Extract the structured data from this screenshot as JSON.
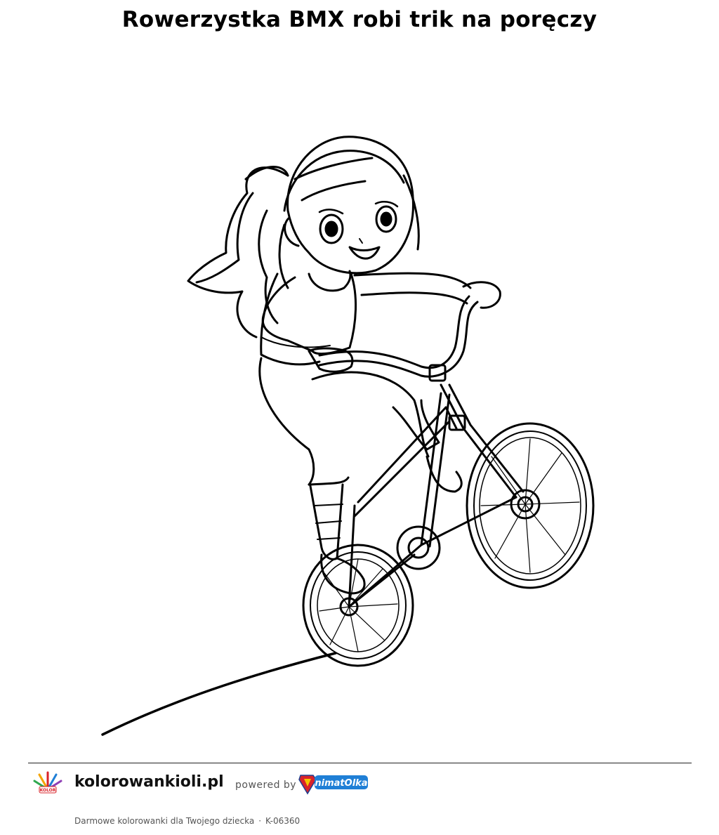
{
  "title": "Rowerzystka BMX robi trik na poręczy",
  "image": {
    "subject": "coloring-page-girl-bmx"
  },
  "footer": {
    "site_name": "kolorowankioli.pl",
    "powered_by": "powered by",
    "site_logo_text": "KolorowankiOli",
    "partner_logo_text": "AnimatOlka",
    "tagline": "Darmowe kolorowanki dla Twojego dziecka",
    "separator": "·",
    "code": "K-06360"
  },
  "colors": {
    "line": "#000000",
    "background": "#ffffff",
    "partner_blue": "#1f7fd6",
    "partner_red": "#d8232a",
    "partner_yellow": "#f5c400"
  }
}
